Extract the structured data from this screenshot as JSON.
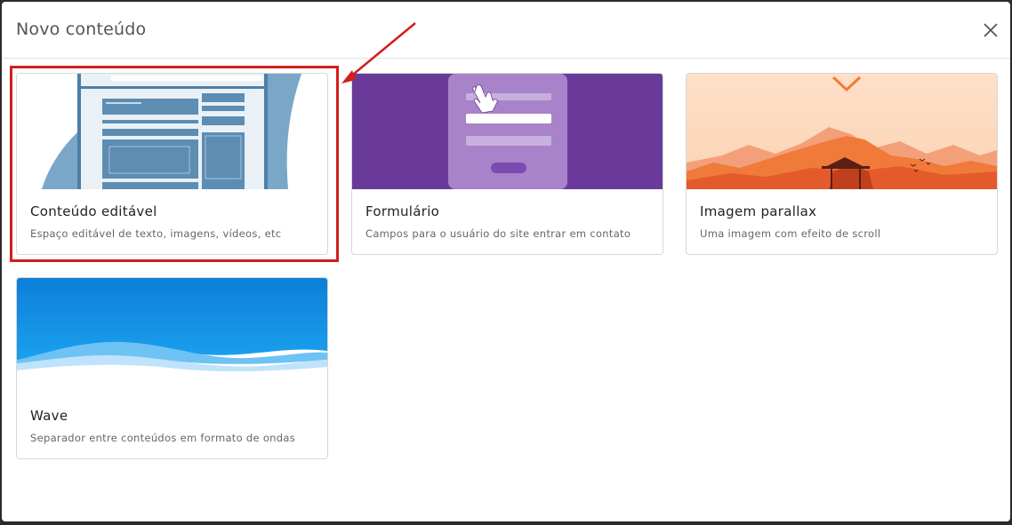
{
  "modal": {
    "title": "Novo conteúdo",
    "close_icon": "close-icon"
  },
  "cards": [
    {
      "title": "Conteúdo editável",
      "description": "Espaço editável de texto, imagens, vídeos, etc",
      "icon": "editable-content-thumbnail"
    },
    {
      "title": "Formulário",
      "description": "Campos para o usuário do site entrar em contato",
      "icon": "form-thumbnail"
    },
    {
      "title": "Imagem parallax",
      "description": "Uma imagem com efeito de scroll",
      "icon": "parallax-image-thumbnail"
    },
    {
      "title": "Wave",
      "description": "Separador entre conteúdos em formato de ondas",
      "icon": "wave-thumbnail"
    }
  ],
  "colors": {
    "highlight": "#d41d1d",
    "form_purple": "#6a3a9a",
    "parallax_orange": "#f07a3a",
    "wave_blue": "#1a8fe0"
  }
}
